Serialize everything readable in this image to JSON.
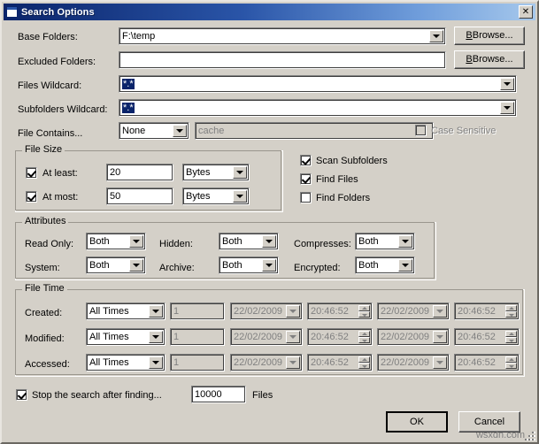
{
  "window": {
    "title": "Search Options",
    "icon": "window-icon",
    "close_label": "✕"
  },
  "fields": {
    "base_folders": {
      "label": "Base Folders:",
      "value": "F:\\temp",
      "browse": "Browse..."
    },
    "excluded_folders": {
      "label": "Excluded Folders:",
      "value": "",
      "browse": "Browse..."
    },
    "files_wildcard": {
      "label": "Files Wildcard:",
      "value": "*.*"
    },
    "subfolders_wildcard": {
      "label": "Subfolders Wildcard:",
      "value": "*.*"
    },
    "file_contains": {
      "label": "File Contains...",
      "mode": "None",
      "text_placeholder": "cache",
      "case_sensitive_label": "Case Sensitive",
      "case_sensitive_checked": false
    }
  },
  "file_size": {
    "title": "File Size",
    "at_least": {
      "label": "At least:",
      "checked": true,
      "value": "20",
      "unit": "Bytes"
    },
    "at_most": {
      "label": "At most:",
      "checked": true,
      "value": "50",
      "unit": "Bytes"
    }
  },
  "scan_options": {
    "scan_subfolders": {
      "label": "Scan Subfolders",
      "checked": true
    },
    "find_files": {
      "label": "Find Files",
      "checked": true
    },
    "find_folders": {
      "label": "Find Folders",
      "checked": false
    }
  },
  "attributes": {
    "title": "Attributes",
    "items": [
      {
        "label": "Read Only:",
        "value": "Both"
      },
      {
        "label": "Hidden:",
        "value": "Both"
      },
      {
        "label": "Compresses:",
        "value": "Both"
      },
      {
        "label": "System:",
        "value": "Both"
      },
      {
        "label": "Archive:",
        "value": "Both"
      },
      {
        "label": "Encrypted:",
        "value": "Both"
      }
    ]
  },
  "file_time": {
    "title": "File Time",
    "rows": [
      {
        "label": "Created:",
        "mode": "All Times",
        "amount": "1",
        "date_from": "22/02/2009",
        "time_from": "20:46:52",
        "date_to": "22/02/2009",
        "time_to": "20:46:52"
      },
      {
        "label": "Modified:",
        "mode": "All Times",
        "amount": "1",
        "date_from": "22/02/2009",
        "time_from": "20:46:52",
        "date_to": "22/02/2009",
        "time_to": "20:46:52"
      },
      {
        "label": "Accessed:",
        "mode": "All Times",
        "amount": "1",
        "date_from": "22/02/2009",
        "time_from": "20:46:52",
        "date_to": "22/02/2009",
        "time_to": "20:46:52"
      }
    ]
  },
  "stop_search": {
    "label": "Stop the search after finding...",
    "checked": true,
    "value": "10000",
    "suffix": "Files"
  },
  "buttons": {
    "ok": "OK",
    "cancel": "Cancel"
  },
  "watermark": "wsxdn.com"
}
